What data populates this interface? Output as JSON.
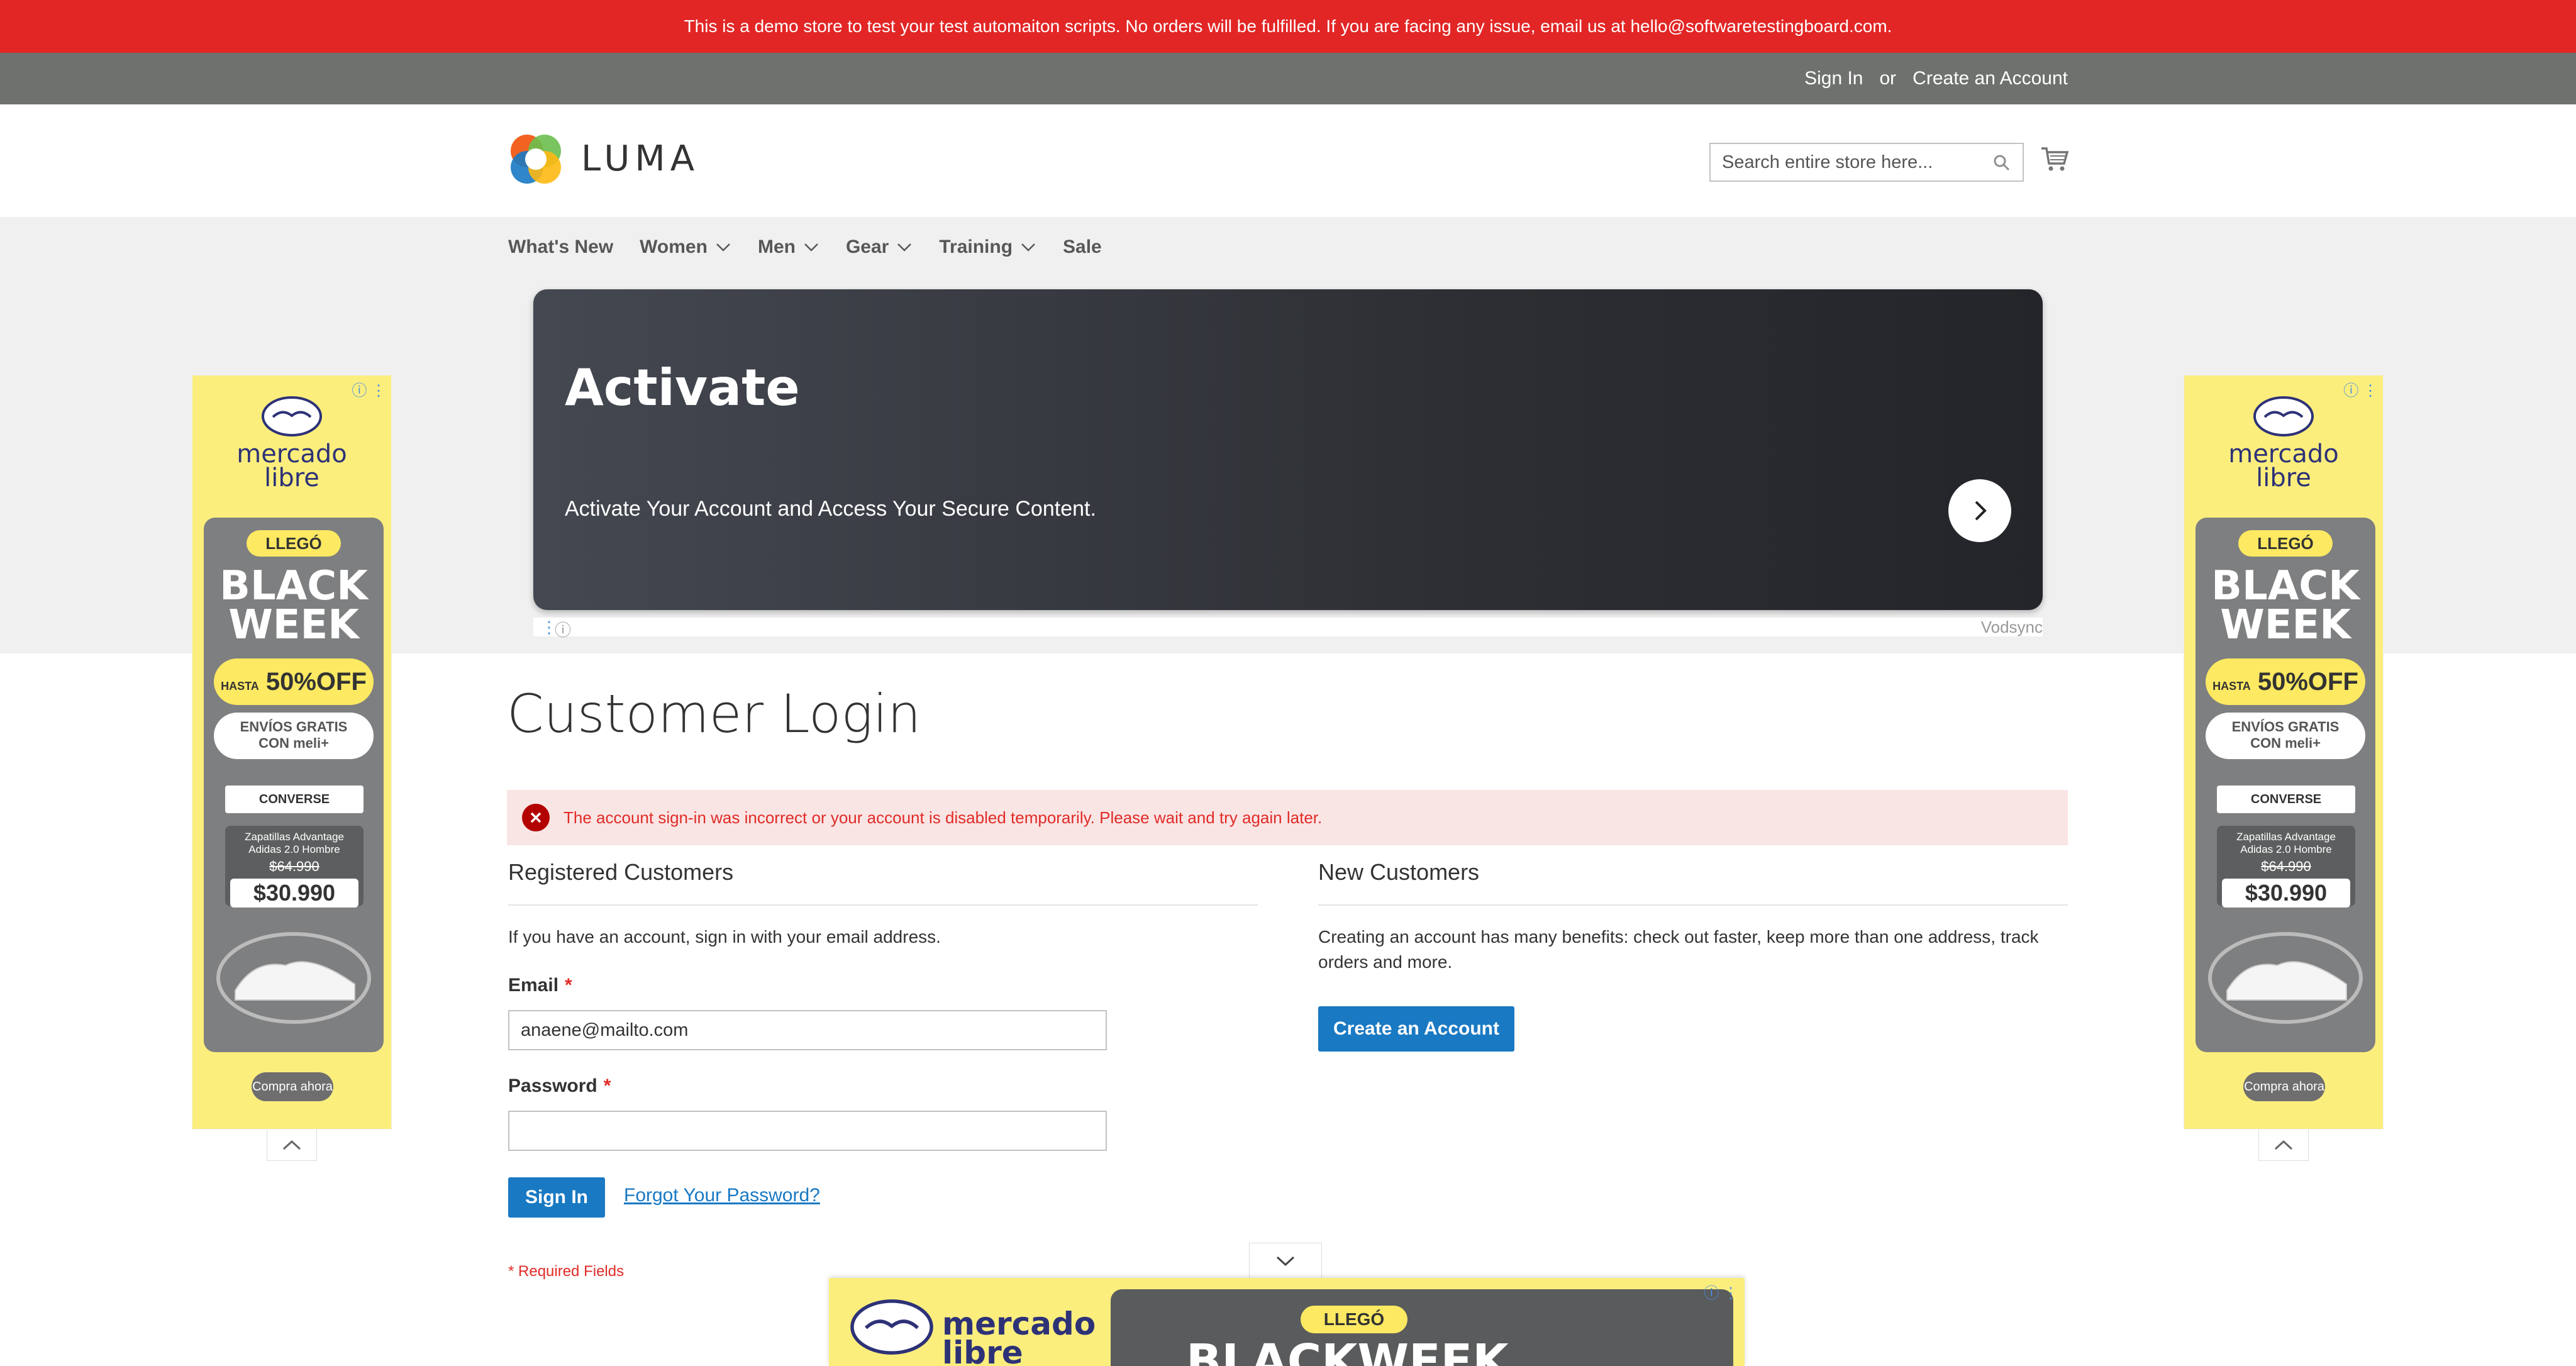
{
  "demo_notice": "This is a demo store to test your test automaiton scripts. No orders will be fulfilled. If you are facing any issue, email us at hello@softwaretestingboard.com.",
  "header_links": {
    "sign_in": "Sign In",
    "or": "or",
    "create_account": "Create an Account"
  },
  "logo": {
    "text": "LUMA"
  },
  "search": {
    "placeholder": "Search entire store here...",
    "icon": "search-icon"
  },
  "cart": {
    "icon": "cart-icon"
  },
  "nav": [
    {
      "label": "What's New",
      "has_dropdown": false
    },
    {
      "label": "Women",
      "has_dropdown": true
    },
    {
      "label": "Men",
      "has_dropdown": true
    },
    {
      "label": "Gear",
      "has_dropdown": true
    },
    {
      "label": "Training",
      "has_dropdown": true
    },
    {
      "label": "Sale",
      "has_dropdown": false
    }
  ],
  "hero_ad": {
    "title": "Activate",
    "text": "Activate Your Account and Access Your Secure Content.",
    "advertiser": "Vodsync"
  },
  "side_ad": {
    "brand_line1": "mercado",
    "brand_line2": "libre",
    "llego": "LLEGÓ",
    "headline_line1": "BLACK",
    "headline_line2": "WEEK",
    "discount_prefix": "HASTA",
    "discount": "50%OFF",
    "shipping_line1": "ENVÍOS GRATIS",
    "shipping_line2": "CON meli+",
    "brands": "CONVERSE",
    "product_line1": "Zapatillas Advantage",
    "product_line2": "Adidas 2.0 Hombre",
    "old_price": "$64.990",
    "price": "$30.990",
    "cta": "Compra ahora"
  },
  "page": {
    "title": "Customer Login",
    "error": "The account sign-in was incorrect or your account is disabled temporarily. Please wait and try again later."
  },
  "registered": {
    "title": "Registered Customers",
    "note": "If you have an account, sign in with your email address.",
    "email_label": "Email",
    "email_value": "anaene@mailto.com",
    "password_label": "Password",
    "password_value": "",
    "required_mark": "*",
    "sign_in_button": "Sign In",
    "forgot_link": "Forgot Your Password?",
    "required_note": "* Required Fields"
  },
  "new_customers": {
    "title": "New Customers",
    "note": "Creating an account has many benefits: check out faster, keep more than one address, track orders and more.",
    "button": "Create an Account"
  },
  "bottom_ad": {
    "brand_line1": "mercado",
    "brand_line2": "libre",
    "llego": "LLEGÓ",
    "headline": "BLACKWEEK"
  },
  "colors": {
    "demo_bar": "#e22626",
    "panel_header": "#6e716e",
    "primary_button": "#1979c3",
    "error_bg": "#fae5e5",
    "error_text": "#e02b27"
  }
}
